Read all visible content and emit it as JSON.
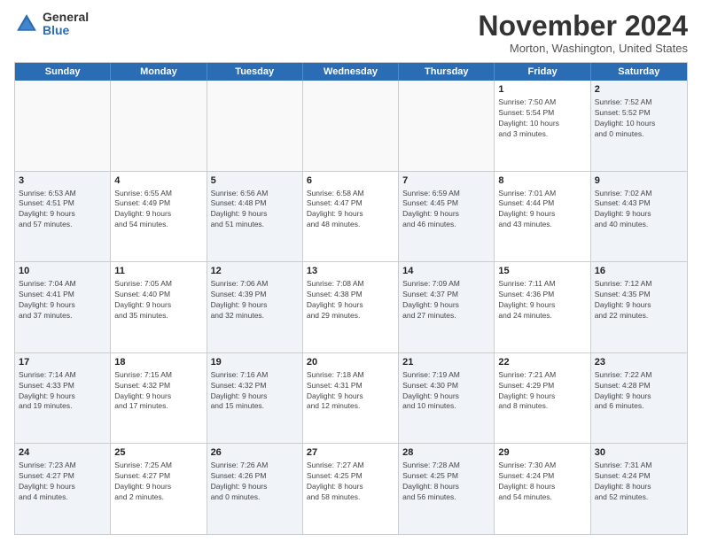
{
  "logo": {
    "general": "General",
    "blue": "Blue"
  },
  "header": {
    "month": "November 2024",
    "location": "Morton, Washington, United States"
  },
  "days": [
    "Sunday",
    "Monday",
    "Tuesday",
    "Wednesday",
    "Thursday",
    "Friday",
    "Saturday"
  ],
  "weeks": [
    [
      {
        "day": "",
        "info": ""
      },
      {
        "day": "",
        "info": ""
      },
      {
        "day": "",
        "info": ""
      },
      {
        "day": "",
        "info": ""
      },
      {
        "day": "",
        "info": ""
      },
      {
        "day": "1",
        "info": "Sunrise: 7:50 AM\nSunset: 5:54 PM\nDaylight: 10 hours\nand 3 minutes."
      },
      {
        "day": "2",
        "info": "Sunrise: 7:52 AM\nSunset: 5:52 PM\nDaylight: 10 hours\nand 0 minutes."
      }
    ],
    [
      {
        "day": "3",
        "info": "Sunrise: 6:53 AM\nSunset: 4:51 PM\nDaylight: 9 hours\nand 57 minutes."
      },
      {
        "day": "4",
        "info": "Sunrise: 6:55 AM\nSunset: 4:49 PM\nDaylight: 9 hours\nand 54 minutes."
      },
      {
        "day": "5",
        "info": "Sunrise: 6:56 AM\nSunset: 4:48 PM\nDaylight: 9 hours\nand 51 minutes."
      },
      {
        "day": "6",
        "info": "Sunrise: 6:58 AM\nSunset: 4:47 PM\nDaylight: 9 hours\nand 48 minutes."
      },
      {
        "day": "7",
        "info": "Sunrise: 6:59 AM\nSunset: 4:45 PM\nDaylight: 9 hours\nand 46 minutes."
      },
      {
        "day": "8",
        "info": "Sunrise: 7:01 AM\nSunset: 4:44 PM\nDaylight: 9 hours\nand 43 minutes."
      },
      {
        "day": "9",
        "info": "Sunrise: 7:02 AM\nSunset: 4:43 PM\nDaylight: 9 hours\nand 40 minutes."
      }
    ],
    [
      {
        "day": "10",
        "info": "Sunrise: 7:04 AM\nSunset: 4:41 PM\nDaylight: 9 hours\nand 37 minutes."
      },
      {
        "day": "11",
        "info": "Sunrise: 7:05 AM\nSunset: 4:40 PM\nDaylight: 9 hours\nand 35 minutes."
      },
      {
        "day": "12",
        "info": "Sunrise: 7:06 AM\nSunset: 4:39 PM\nDaylight: 9 hours\nand 32 minutes."
      },
      {
        "day": "13",
        "info": "Sunrise: 7:08 AM\nSunset: 4:38 PM\nDaylight: 9 hours\nand 29 minutes."
      },
      {
        "day": "14",
        "info": "Sunrise: 7:09 AM\nSunset: 4:37 PM\nDaylight: 9 hours\nand 27 minutes."
      },
      {
        "day": "15",
        "info": "Sunrise: 7:11 AM\nSunset: 4:36 PM\nDaylight: 9 hours\nand 24 minutes."
      },
      {
        "day": "16",
        "info": "Sunrise: 7:12 AM\nSunset: 4:35 PM\nDaylight: 9 hours\nand 22 minutes."
      }
    ],
    [
      {
        "day": "17",
        "info": "Sunrise: 7:14 AM\nSunset: 4:33 PM\nDaylight: 9 hours\nand 19 minutes."
      },
      {
        "day": "18",
        "info": "Sunrise: 7:15 AM\nSunset: 4:32 PM\nDaylight: 9 hours\nand 17 minutes."
      },
      {
        "day": "19",
        "info": "Sunrise: 7:16 AM\nSunset: 4:32 PM\nDaylight: 9 hours\nand 15 minutes."
      },
      {
        "day": "20",
        "info": "Sunrise: 7:18 AM\nSunset: 4:31 PM\nDaylight: 9 hours\nand 12 minutes."
      },
      {
        "day": "21",
        "info": "Sunrise: 7:19 AM\nSunset: 4:30 PM\nDaylight: 9 hours\nand 10 minutes."
      },
      {
        "day": "22",
        "info": "Sunrise: 7:21 AM\nSunset: 4:29 PM\nDaylight: 9 hours\nand 8 minutes."
      },
      {
        "day": "23",
        "info": "Sunrise: 7:22 AM\nSunset: 4:28 PM\nDaylight: 9 hours\nand 6 minutes."
      }
    ],
    [
      {
        "day": "24",
        "info": "Sunrise: 7:23 AM\nSunset: 4:27 PM\nDaylight: 9 hours\nand 4 minutes."
      },
      {
        "day": "25",
        "info": "Sunrise: 7:25 AM\nSunset: 4:27 PM\nDaylight: 9 hours\nand 2 minutes."
      },
      {
        "day": "26",
        "info": "Sunrise: 7:26 AM\nSunset: 4:26 PM\nDaylight: 9 hours\nand 0 minutes."
      },
      {
        "day": "27",
        "info": "Sunrise: 7:27 AM\nSunset: 4:25 PM\nDaylight: 8 hours\nand 58 minutes."
      },
      {
        "day": "28",
        "info": "Sunrise: 7:28 AM\nSunset: 4:25 PM\nDaylight: 8 hours\nand 56 minutes."
      },
      {
        "day": "29",
        "info": "Sunrise: 7:30 AM\nSunset: 4:24 PM\nDaylight: 8 hours\nand 54 minutes."
      },
      {
        "day": "30",
        "info": "Sunrise: 7:31 AM\nSunset: 4:24 PM\nDaylight: 8 hours\nand 52 minutes."
      }
    ]
  ]
}
